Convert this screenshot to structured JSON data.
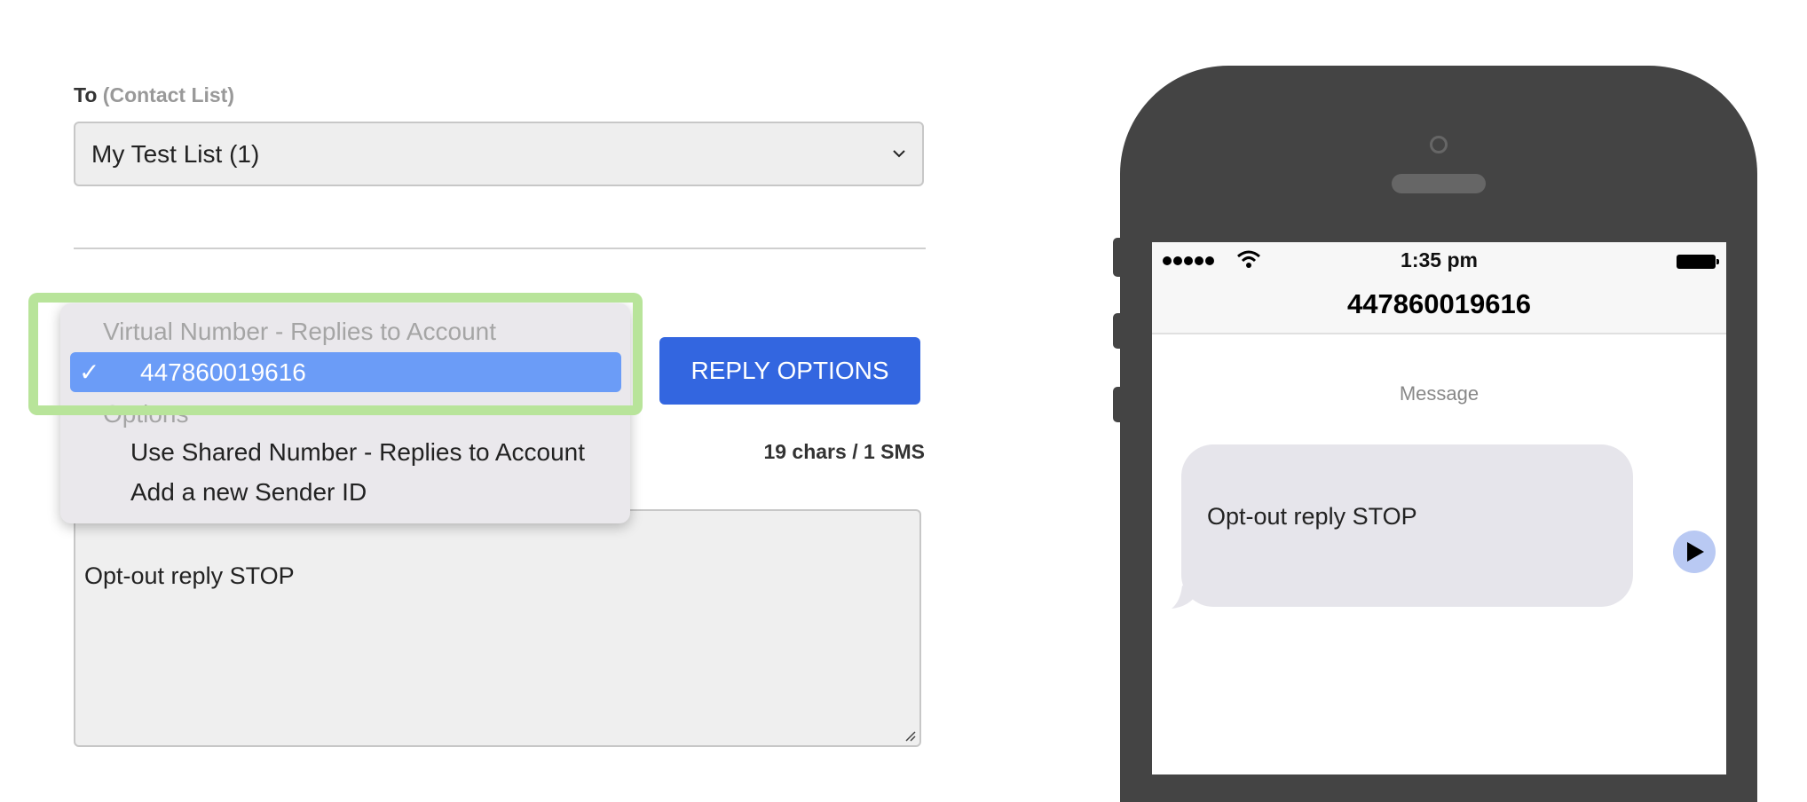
{
  "to_field": {
    "label": "To",
    "sublabel": "(Contact List)",
    "selected_value": "My Test List (1)"
  },
  "sender_dropdown": {
    "group1_label": "Virtual Number - Replies to Account",
    "selected_option": "447860019616",
    "group2_label": "Options",
    "options": [
      "Use Shared Number - Replies to Account",
      "Add a new Sender ID"
    ],
    "check_glyph": "✓"
  },
  "reply_options_button": "REPLY OPTIONS",
  "char_count": "19 chars / 1 SMS",
  "message_text": "Opt-out reply STOP",
  "phone_preview": {
    "status_time": "1:35 pm",
    "contact": "447860019616",
    "message_label": "Message",
    "bubble_text": "Opt-out reply STOP"
  },
  "colors": {
    "accent_button": "#3366e0",
    "dropdown_selected": "#6b9cf7",
    "highlight_border": "#b8e49a",
    "phone_body": "#444444"
  }
}
